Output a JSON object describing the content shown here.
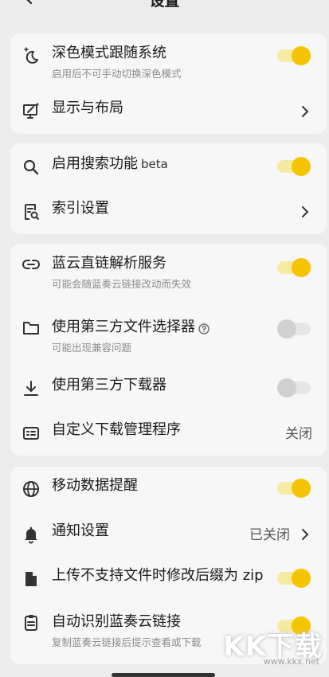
{
  "header": {
    "title": "设置"
  },
  "sections": {
    "appearance": {
      "dark_mode": {
        "label": "深色模式跟随系统",
        "desc": "启用后不可手动切换深色模式",
        "state": "on"
      },
      "display_layout": {
        "label": "显示与布局"
      }
    },
    "search": {
      "enable_search": {
        "label": "启用搜索功能",
        "badge": "beta",
        "state": "on"
      },
      "index_settings": {
        "label": "索引设置"
      }
    },
    "download": {
      "lanzou_direct": {
        "label": "蓝云直链解析服务",
        "desc": "可能会随蓝奏云链接改动而失效",
        "state": "on"
      },
      "file_picker": {
        "label": "使用第三方文件选择器",
        "desc": "可能出现兼容问题",
        "state": "off"
      },
      "third_downloader": {
        "label": "使用第三方下载器",
        "state": "off"
      },
      "custom_manager": {
        "label": "自定义下载管理程序",
        "value": "关闭"
      }
    },
    "misc": {
      "mobile_data": {
        "label": "移动数据提醒",
        "state": "on"
      },
      "notifications": {
        "label": "通知设置",
        "value": "已关闭"
      },
      "zip_suffix": {
        "label": "上传不支持文件时修改后缀为 zip",
        "state": "on"
      },
      "auto_detect": {
        "label": "自动识别蓝奏云链接",
        "desc": "复制蓝奏云链接后提示查看或下载",
        "state": "on"
      }
    }
  },
  "watermark": {
    "mark": "KK下载",
    "url": "www.kkx.net"
  },
  "colors": {
    "accent": "#f5c400",
    "background": "#ececec",
    "card": "#f7f7f7"
  },
  "icons": {
    "back": "back-arrow-icon",
    "dark_mode": "moon-sparkle-icon",
    "display": "monitor-brush-icon",
    "search": "search-icon",
    "index": "document-search-icon",
    "link": "link-icon",
    "folder": "folder-icon",
    "download": "download-icon",
    "manager": "download-manager-icon",
    "globe": "globe-icon",
    "bell": "bell-icon",
    "file": "file-icon",
    "clipboard": "clipboard-icon"
  }
}
